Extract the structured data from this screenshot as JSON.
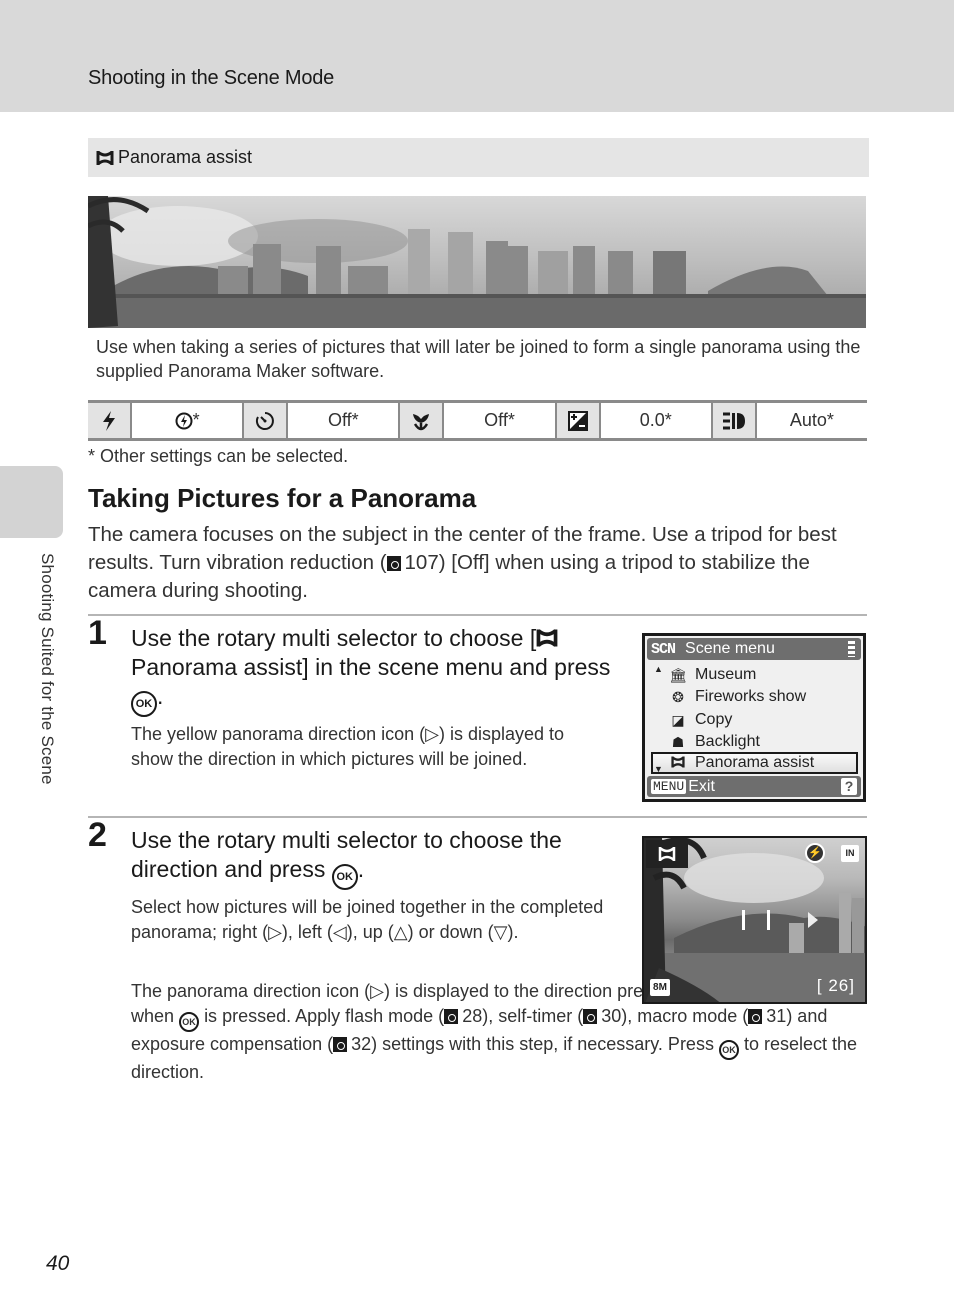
{
  "header": {
    "section_title": "Shooting in the Scene Mode"
  },
  "side_tab": {
    "label": "Shooting Suited for the Scene"
  },
  "scene_box": {
    "icon": "panorama-assist-icon",
    "title": "Panorama assist",
    "photo_alt": "Panorama of city skyline along waterfront",
    "description": "Use when taking a series of pictures that will later be joined to form a single panorama using the supplied Panorama Maker software."
  },
  "settings_table": [
    {
      "icon": "flash-icon",
      "glyph": "⚡",
      "value": "⊛*"
    },
    {
      "icon": "self-timer-icon",
      "glyph": "◔",
      "value": "Off*"
    },
    {
      "icon": "macro-icon",
      "glyph": "✿",
      "value": "Off*"
    },
    {
      "icon": "exposure-compensation-icon",
      "glyph": "±",
      "value": "0.0*"
    },
    {
      "icon": "focus-mode-icon",
      "glyph": "☰",
      "value": "Auto*"
    }
  ],
  "settings_footnote": "*  Other settings can be selected.",
  "section": {
    "heading": "Taking Pictures for a Panorama",
    "intro_a": "The camera focuses on the subject in the center of the frame. Use a tripod for best results. Turn vibration reduction (",
    "intro_ref": "107",
    "intro_b": ") [Off] when using a tripod to stabilize the camera during shooting."
  },
  "steps": [
    {
      "number": "1",
      "heading_a": "Use the rotary multi selector to choose [",
      "heading_b": "Panorama assist] in the scene menu and press",
      "heading_ok": "OK",
      "body": "The yellow panorama direction icon (▷) is displayed to show the direction in which pictures will be joined."
    },
    {
      "number": "2",
      "heading_a": "Use the rotary multi selector to choose the direction and press",
      "heading_ok": "OK",
      "body1": "Select how pictures will be joined together in the completed panorama; right (▷), left (◁), up (△) or down (▽).",
      "body2_a": "The panorama direction icon (▷) is displayed to the direction pressed and changes to white when",
      "body2_b": "is pressed. Apply flash mode (",
      "ref_flash": "28",
      "body2_c": "), self-timer (",
      "ref_timer": "30",
      "body2_d": "), macro mode (",
      "ref_macro": "31",
      "body2_e": ") and exposure compensation (",
      "ref_exposure": "32",
      "body2_f": ") settings with this step, if necessary. Press",
      "body2_g": "to reselect the direction.",
      "ok": "OK"
    }
  ],
  "camera_menu": {
    "badge": "SCN",
    "title": "Scene menu",
    "items": [
      {
        "icon": "museum-icon",
        "glyph": "🏛",
        "label": "Museum"
      },
      {
        "icon": "fireworks-icon",
        "glyph": "❂",
        "label": "Fireworks show"
      },
      {
        "icon": "copy-icon",
        "glyph": "◪",
        "label": "Copy"
      },
      {
        "icon": "backlight-icon",
        "glyph": "☗",
        "label": "Backlight"
      },
      {
        "icon": "panorama-assist-icon",
        "glyph": "⌛",
        "label": "Panorama assist",
        "selected": true
      }
    ],
    "footer_badge": "MENU",
    "footer_label": "Exit",
    "help": "?"
  },
  "camera_view": {
    "flash_glyph": "⚡",
    "memory": "IN",
    "image_size": "8M",
    "shots_remaining": "[   26]"
  },
  "page_number": "40"
}
